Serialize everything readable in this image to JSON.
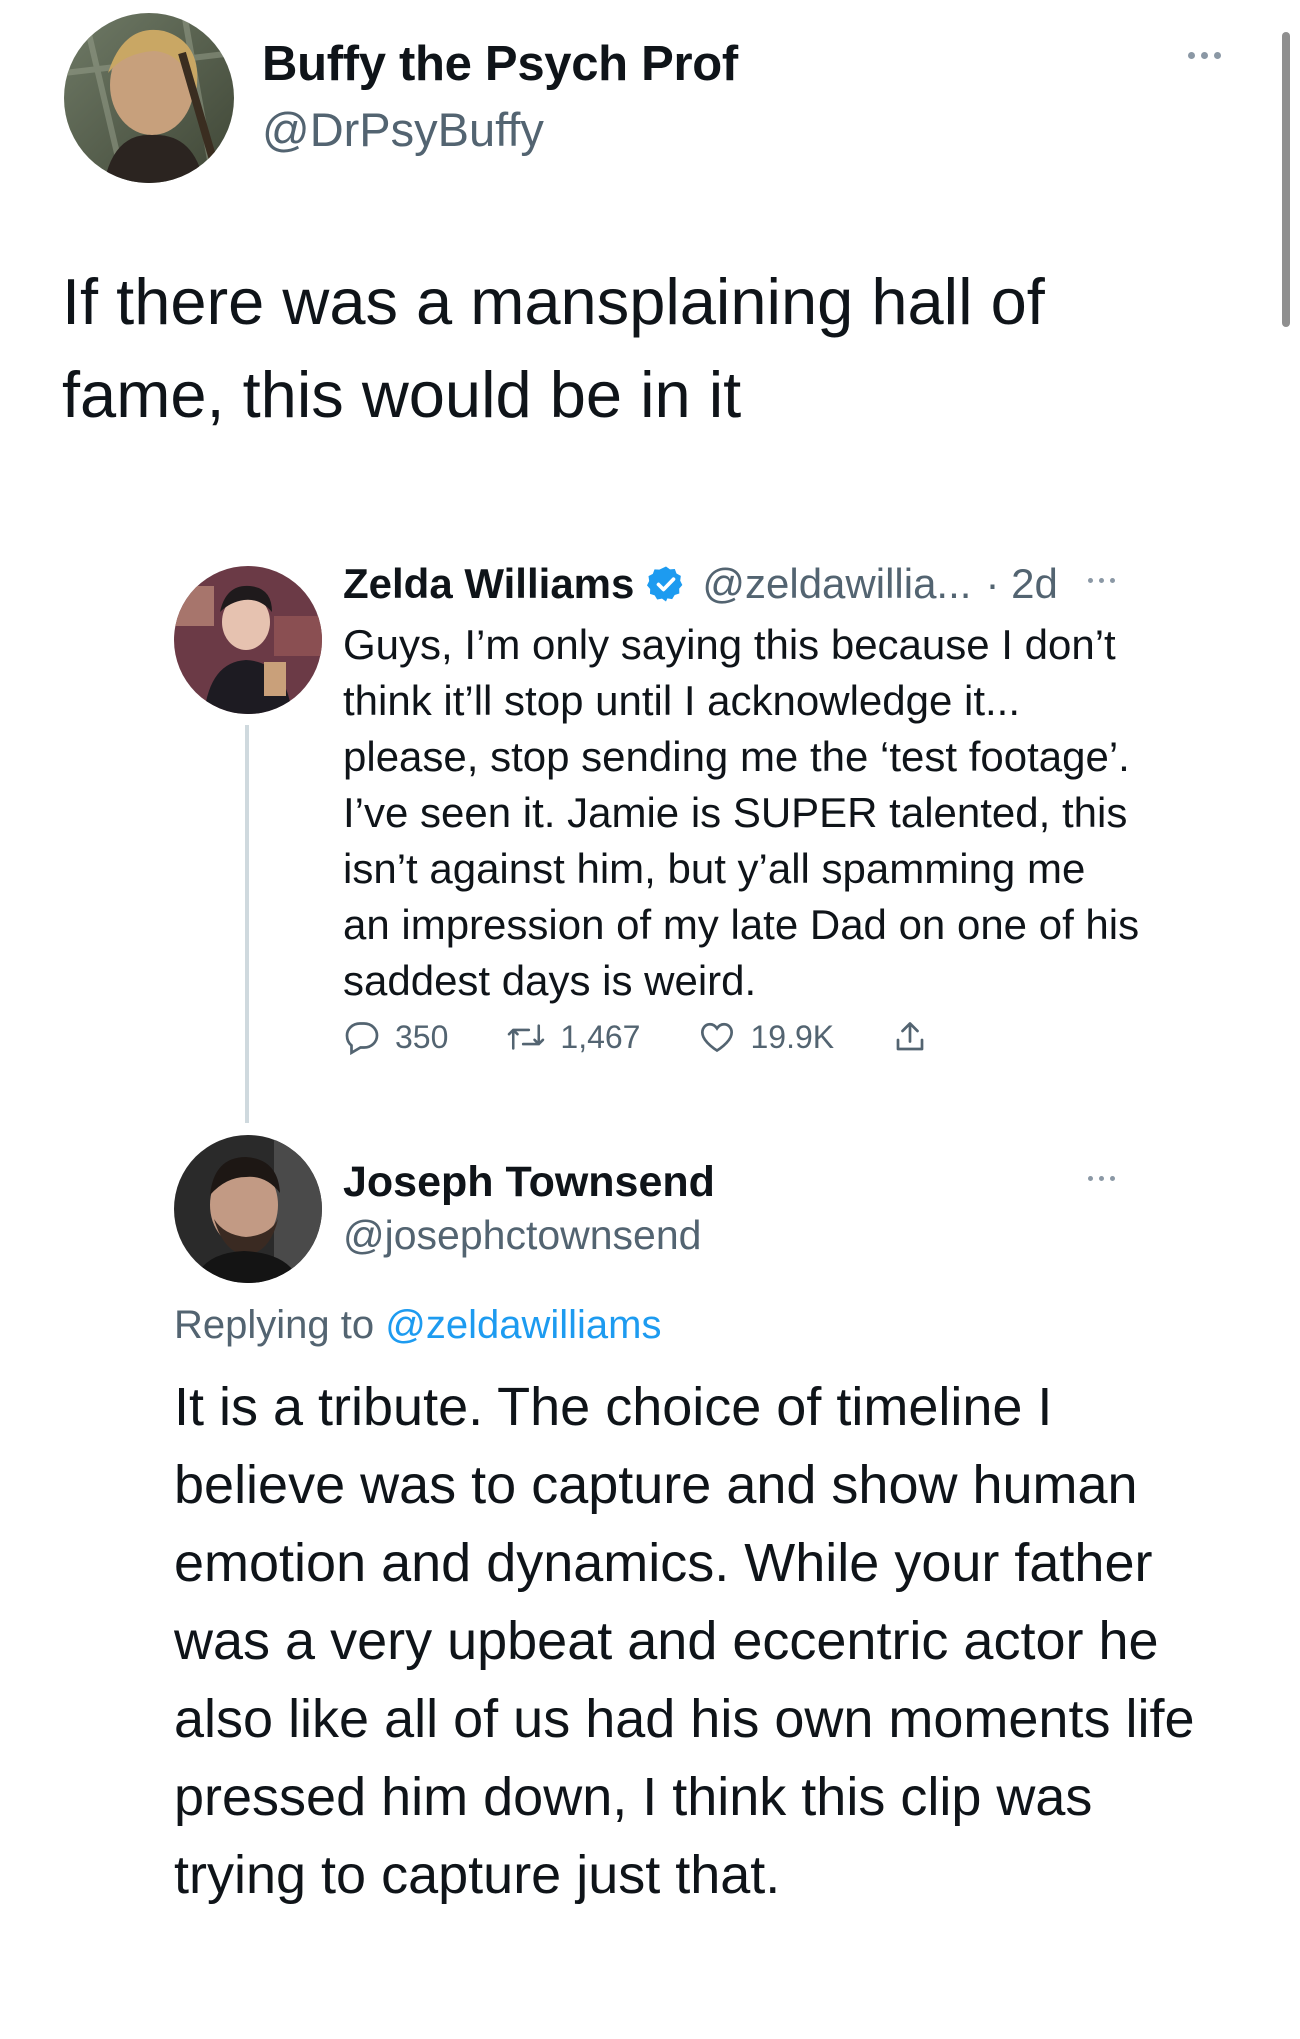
{
  "main_tweet": {
    "display_name": "Buffy the Psych Prof",
    "handle": "@DrPsyBuffy",
    "text": "If there was a mansplaining hall of fame, this would be in it"
  },
  "quoted_tweet": {
    "display_name": "Zelda Williams",
    "handle": "@zeldawillia...",
    "time": "· 2d",
    "text": "Guys, I’m only saying this because I don’t think it’ll stop until I acknowledge it... please, stop sending me the ‘test footage’. I’ve seen it. Jamie is SUPER talented, this isn’t against him, but y’all spamming me an impression of my late Dad on one of his saddest days is weird.",
    "replies": "350",
    "retweets": "1,467",
    "likes": "19.9K"
  },
  "reply_tweet": {
    "display_name": "Joseph Townsend",
    "handle": "@josephctownsend",
    "replying_prefix": "Replying to",
    "replying_to": "@zeldawilliams",
    "text": "It is a tribute. The choice of timeline I believe was to capture and show human emotion and dynamics. While your father was a very upbeat and eccentric actor he also like all of us had his own moments life pressed him down, I think this clip was trying to capture just that."
  },
  "icons": {
    "verified": "verified-badge-icon",
    "reply": "reply-bubble-icon",
    "retweet": "retweet-icon",
    "like": "heart-icon",
    "share": "share-icon",
    "more": "more-dots-icon"
  },
  "colors": {
    "text": "#0f1419",
    "secondary": "#536471",
    "link": "#1d9bf0",
    "verified": "#1d9bf0",
    "thread_line": "#cfd9de"
  }
}
